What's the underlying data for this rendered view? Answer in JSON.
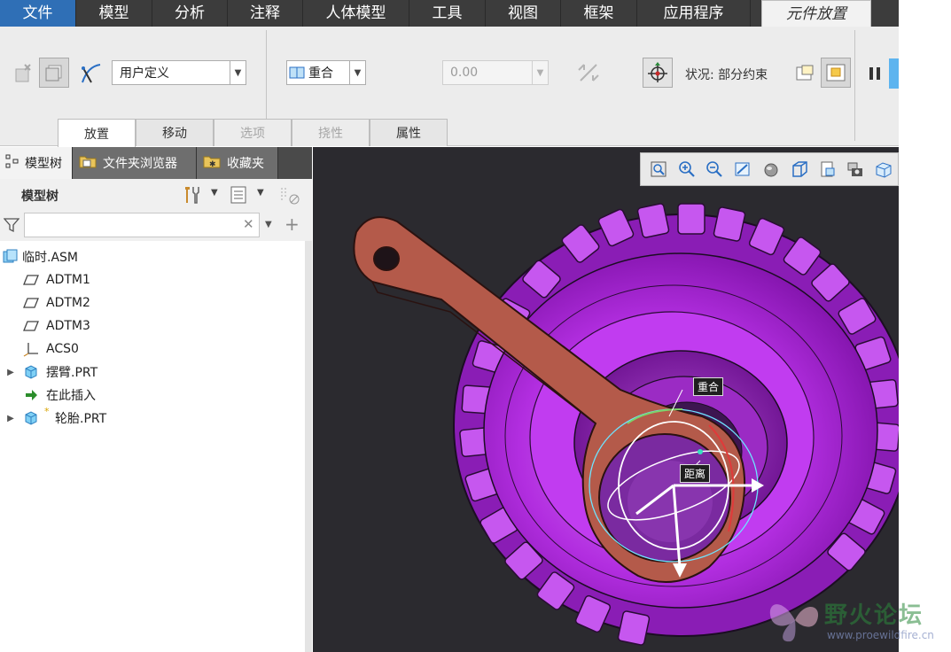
{
  "menubar": {
    "items": [
      "文件",
      "模型",
      "分析",
      "注释",
      "人体模型",
      "工具",
      "视图",
      "框架",
      "应用程序",
      "元件放置"
    ],
    "active": "元件放置"
  },
  "ribbon": {
    "constraint_set": "用户定义",
    "constraint_type": "重合",
    "offset_value": "0.00",
    "status_text": "状况: 部分约束",
    "tabs": [
      "放置",
      "移动",
      "选项",
      "挠性",
      "属性"
    ],
    "active_tab": "放置",
    "disabled_tabs": [
      "选项",
      "挠性"
    ]
  },
  "panel_tabs": [
    "模型树",
    "文件夹浏览器",
    "收藏夹"
  ],
  "tree": {
    "title": "模型树",
    "filter_placeholder": "",
    "items": [
      {
        "label": "临时.ASM",
        "icon": "assembly-icon"
      },
      {
        "label": "ADTM1",
        "icon": "datum-plane-icon"
      },
      {
        "label": "ADTM2",
        "icon": "datum-plane-icon"
      },
      {
        "label": "ADTM3",
        "icon": "datum-plane-icon"
      },
      {
        "label": "ACS0",
        "icon": "coordinate-system-icon"
      },
      {
        "label": "摆臂.PRT",
        "icon": "part-icon"
      },
      {
        "label": "在此插入",
        "icon": "insert-here-arrow-icon"
      },
      {
        "label": "轮胎.PRT",
        "icon": "part-icon"
      }
    ]
  },
  "viewport": {
    "tag_coincident": "重合",
    "tag_distance": "距离"
  },
  "watermark": {
    "title": "野火论坛",
    "url": "www.proewildfire.cn"
  },
  "colors": {
    "menubar_bg": "#3c3c3c",
    "file_menu_bg": "#2f6fb6",
    "viewport_bg": "#2b2a2f",
    "tire_color": "#b532e0",
    "arm_color": "#b45a4a"
  }
}
